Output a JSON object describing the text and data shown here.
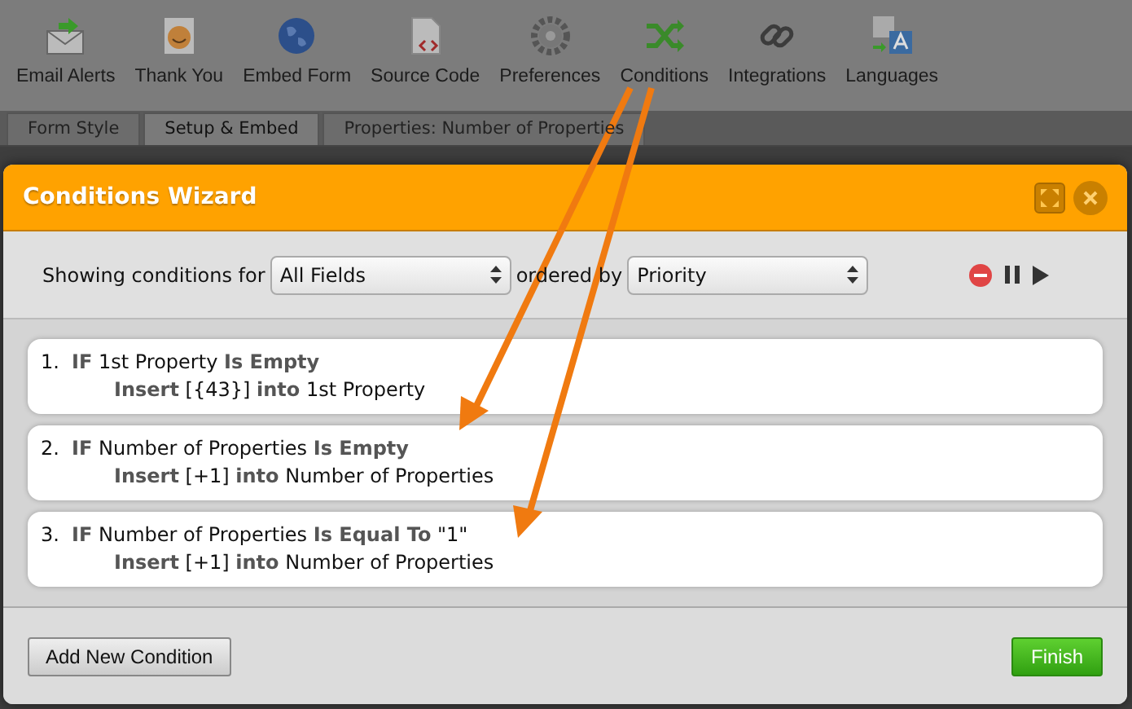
{
  "toolbar": [
    {
      "label": "Email Alerts"
    },
    {
      "label": "Thank You"
    },
    {
      "label": "Embed Form"
    },
    {
      "label": "Source Code"
    },
    {
      "label": "Preferences"
    },
    {
      "label": "Conditions"
    },
    {
      "label": "Integrations"
    },
    {
      "label": "Languages"
    }
  ],
  "tabs": [
    {
      "label": "Form Style",
      "selected": false
    },
    {
      "label": "Setup & Embed",
      "selected": true
    },
    {
      "label": "Properties: Number of Properties",
      "selected": false
    }
  ],
  "dialog": {
    "title": "Conditions Wizard",
    "filter": {
      "label": "Showing conditions for",
      "field": "All Fields",
      "order_label": "ordered by",
      "order": "Priority"
    },
    "conditions": [
      {
        "number": "1.",
        "condition": "**IF** 1st Property **Is Empty**",
        "action": "**Insert** [{43}] **into** 1st Property"
      },
      {
        "number": "2.",
        "condition": "**IF** Number of Properties **Is Empty**",
        "action": "**Insert** [+1] **into** Number of Properties"
      },
      {
        "number": "3.",
        "condition": "**IF** Number of Properties **Is Equal To** \"1\"",
        "action": "**Insert** [+1] **into** Number of Properties"
      }
    ],
    "buttons": {
      "add": "Add New Condition",
      "finish": "Finish"
    }
  }
}
